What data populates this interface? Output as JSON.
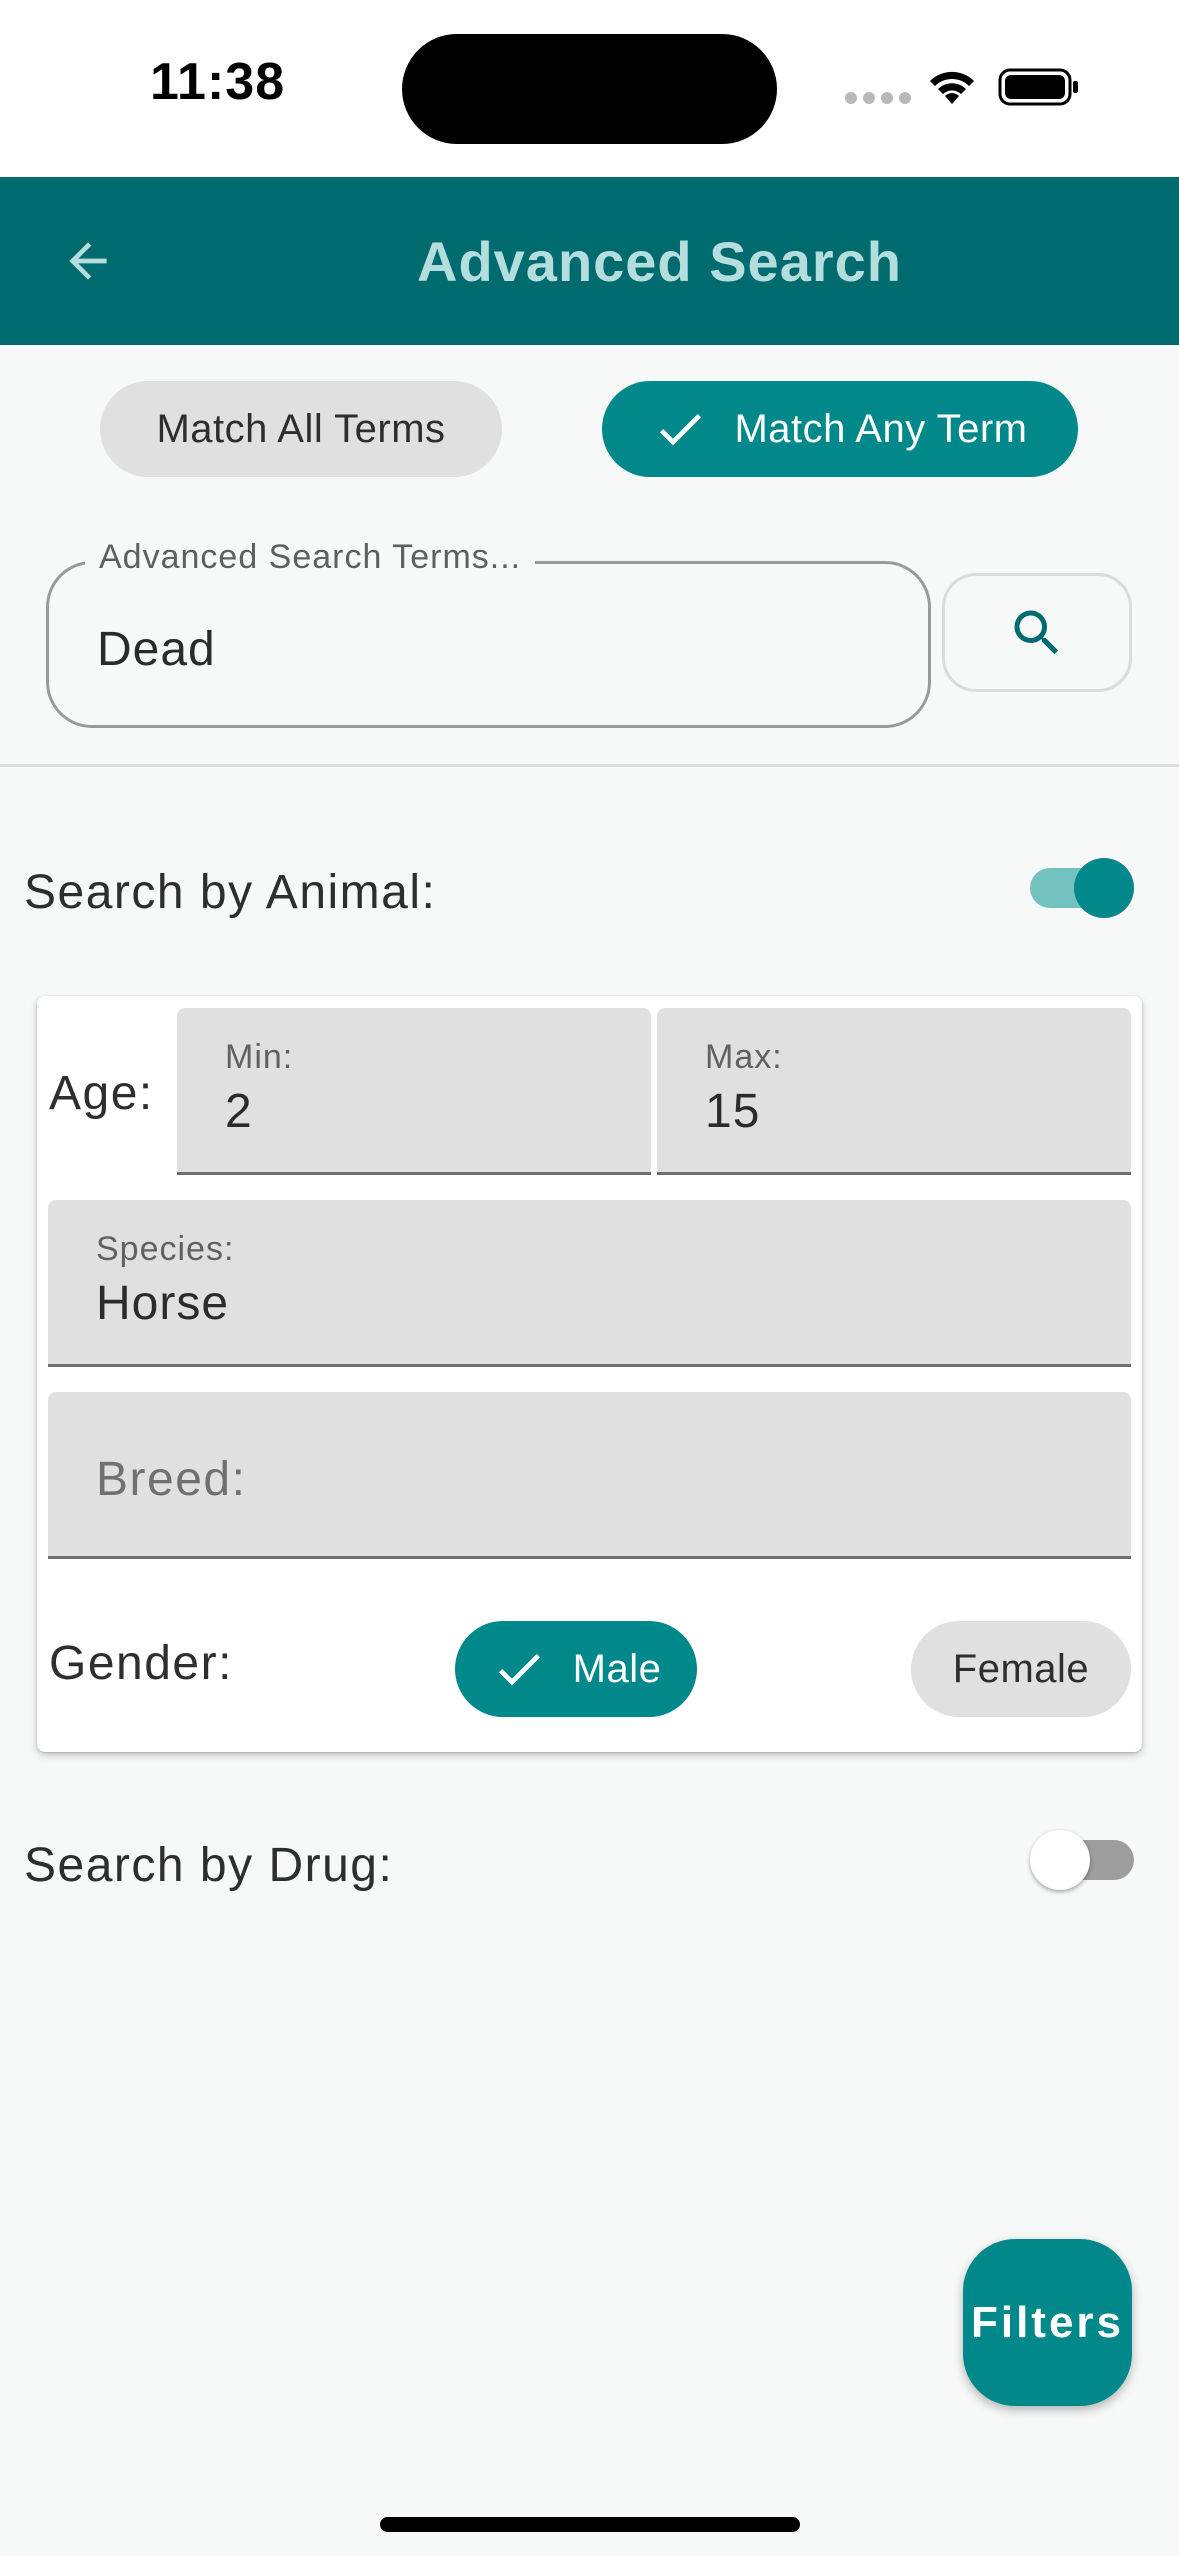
{
  "status_bar": {
    "time": "11:38"
  },
  "app_bar": {
    "title": "Advanced Search",
    "back_icon": "arrow-left-icon"
  },
  "match_mode": {
    "options": [
      {
        "label": "Match All Terms",
        "selected": false
      },
      {
        "label": "Match Any Term",
        "selected": true
      }
    ]
  },
  "search": {
    "label": "Advanced Search Terms...",
    "value": "Dead",
    "button_icon": "search-icon"
  },
  "animal_section": {
    "label": "Search by Animal:",
    "enabled": true,
    "age": {
      "label": "Age:",
      "min_label": "Min:",
      "min_value": "2",
      "max_label": "Max:",
      "max_value": "15"
    },
    "species": {
      "label": "Species:",
      "value": "Horse"
    },
    "breed": {
      "placeholder": "Breed:"
    },
    "gender": {
      "label": "Gender:",
      "options": [
        {
          "label": "Male",
          "selected": true
        },
        {
          "label": "Female",
          "selected": false
        }
      ]
    }
  },
  "drug_section": {
    "label": "Search by Drug:",
    "enabled": false
  },
  "fab": {
    "label": "Filters"
  },
  "colors": {
    "app_bar": "#006b6e",
    "accent": "#00888a",
    "title_text": "#b4dede",
    "chip_unselected": "#e0e0e0"
  }
}
